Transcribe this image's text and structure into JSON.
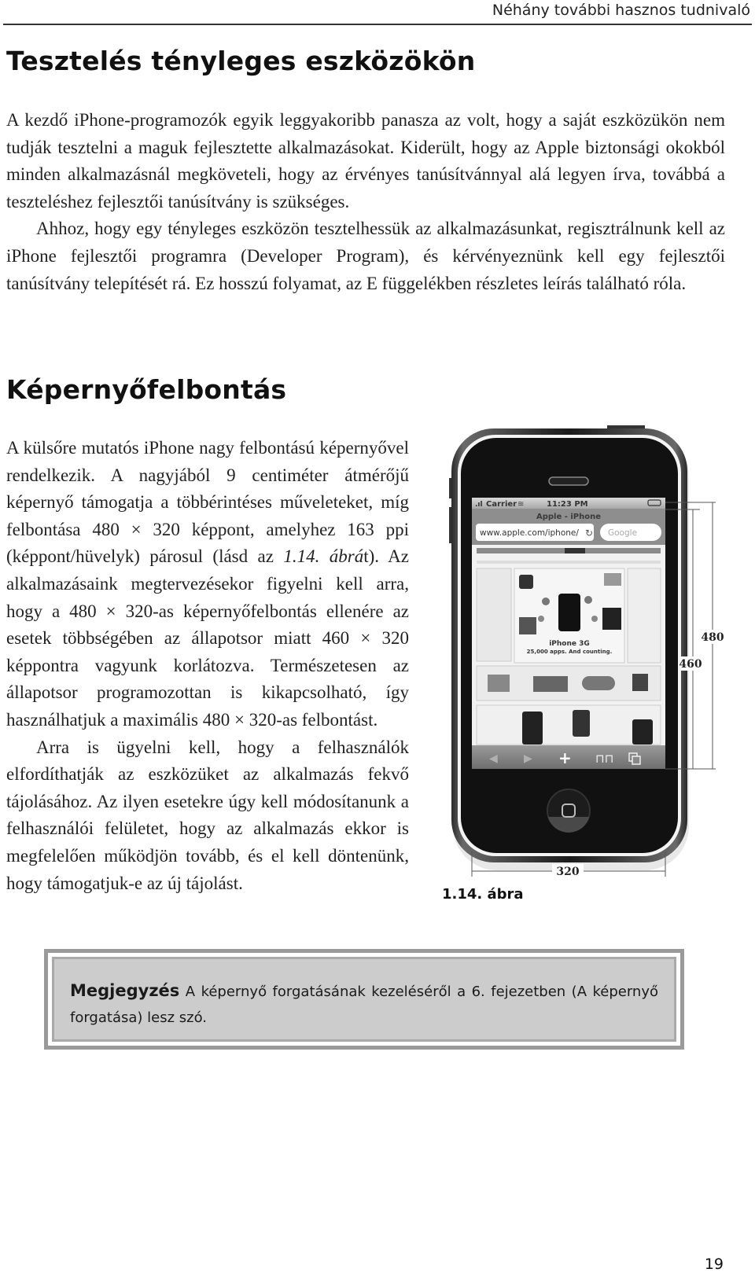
{
  "header": {
    "running_title": "Néhány további hasznos tudnivaló"
  },
  "section1": {
    "title": "Tesztelés tényleges eszközökön",
    "paragraphs": [
      "A kezdő iPhone-programozók egyik leggyakoribb panasza az volt, hogy a saját eszközükön nem tudják tesztelni a maguk fejlesztette alkalmazásokat. Kiderült, hogy az Apple biztonsági okokból minden alkalmazásnál megköveteli, hogy az érvényes tanúsítvánnyal alá legyen írva, továbbá a teszteléshez fejlesztői tanúsítvány is szükséges.",
      "Ahhoz, hogy egy tényleges eszközön tesztelhessük az alkalmazásunkat, regisztrálnunk kell az iPhone fejlesztői programra (Developer Program), és kérvényeznünk kell egy fejlesztői tanúsítvány telepítését rá. Ez hosszú folyamat, az E függelékben részletes leírás található róla."
    ]
  },
  "section2": {
    "title": "Képernyőfelbontás",
    "p1_before": "A külsőre mutatós iPhone nagy felbontású képernyővel rendelkezik. A nagyjából 9 centiméter átmérőjű képernyő támogatja a többérintéses műveleteket, míg felbontása 480 × 320 képpont, amelyhez 163 ppi (képpont/hüvelyk) párosul (lásd az ",
    "p1_ref": "1.14. ábrá",
    "p1_after": "t). Az alkalmazásaink megtervezésekor figyelni kell arra, hogy a 480 × 320-as képernyőfelbontás ellenére az esetek többségében az állapotsor miatt 460 × 320 képpontra vagyunk korlátozva. Természetesen az állapotsor programozottan is kikapcsolható, így használhatjuk a maximális 480 × 320-as felbontást.",
    "p2": "Arra is ügyelni kell, hogy a felhasználók elfordíthatják az eszközüket az alkalmazás fekvő tájolásához. Az ilyen esetekre úgy kell módosítanunk a felhasználói felületet, hogy az alkalmazás ekkor is megfelelően működjön tovább, és el kell döntenünk, hogy támogatjuk-e az új tájolást."
  },
  "figure": {
    "caption": "1.14. ábra",
    "status_bar": {
      "carrier": "Carrier",
      "time": "11:23 PM"
    },
    "browser": {
      "page_title": "Apple - iPhone",
      "url": "www.apple.com/iphone/",
      "search_placeholder": "Google"
    },
    "promo_headline": "iPhone 3G",
    "promo_text": "25,000 apps. And counting.",
    "dimensions": {
      "full_height": "480",
      "usable_height": "460",
      "width": "320"
    }
  },
  "note": {
    "label": "Megjegyzés",
    "text": " A képernyő forgatásának kezeléséről a 6. fejezetben (A képernyő forgatása) lesz szó."
  },
  "footer": {
    "page_number": "19"
  }
}
